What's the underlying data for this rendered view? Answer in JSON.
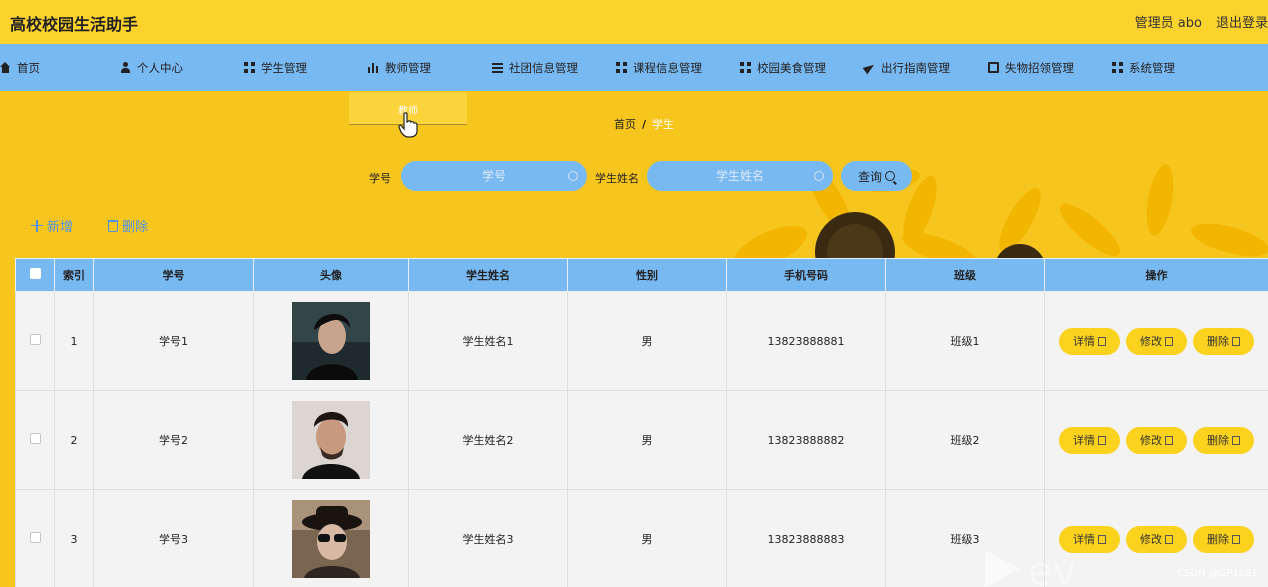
{
  "header": {
    "app_title": "高校校园生活助手",
    "user": "管理员 abo",
    "logout": "退出登录"
  },
  "nav": {
    "items": [
      {
        "label": "首页",
        "icon": "home-icon"
      },
      {
        "label": "个人中心",
        "icon": "person-icon"
      },
      {
        "label": "学生管理",
        "icon": "grid-icon"
      },
      {
        "label": "教师管理",
        "icon": "bar-chart-icon"
      },
      {
        "label": "社团信息管理",
        "icon": "list-icon"
      },
      {
        "label": "课程信息管理",
        "icon": "grid-icon"
      },
      {
        "label": "校园美食管理",
        "icon": "grid-icon"
      },
      {
        "label": "出行指南管理",
        "icon": "send-icon"
      },
      {
        "label": "失物招领管理",
        "icon": "document-icon"
      },
      {
        "label": "系统管理",
        "icon": "grid-icon"
      }
    ],
    "dropdown_item": "教师"
  },
  "breadcrumb": {
    "home": "首页",
    "separator": "/",
    "current": "学生"
  },
  "search": {
    "id_label": "学号",
    "id_placeholder": "学号",
    "name_label": "学生姓名",
    "name_placeholder": "学生姓名",
    "query_label": "查询"
  },
  "actions": {
    "add_label": "新增",
    "delete_label": "删除"
  },
  "table": {
    "headers": [
      "索引",
      "学号",
      "头像",
      "学生姓名",
      "性别",
      "手机号码",
      "班级",
      "操作"
    ],
    "rows": [
      {
        "index": "1",
        "student_id": "学号1",
        "name": "学生姓名1",
        "gender": "男",
        "phone": "13823888881",
        "class": "班级1"
      },
      {
        "index": "2",
        "student_id": "学号2",
        "name": "学生姓名2",
        "gender": "男",
        "phone": "13823888882",
        "class": "班级2"
      },
      {
        "index": "3",
        "student_id": "学号3",
        "name": "学生姓名3",
        "gender": "男",
        "phone": "13823888883",
        "class": "班级3"
      }
    ],
    "row_actions": {
      "detail": "详情",
      "edit": "修改",
      "delete": "删除"
    }
  },
  "watermark": "CSDN @GP1081",
  "colors": {
    "header_yellow": "#fcd32d",
    "nav_blue": "#79b9f2",
    "button_yellow": "#fbd21d",
    "link_blue": "#4e92e6"
  }
}
